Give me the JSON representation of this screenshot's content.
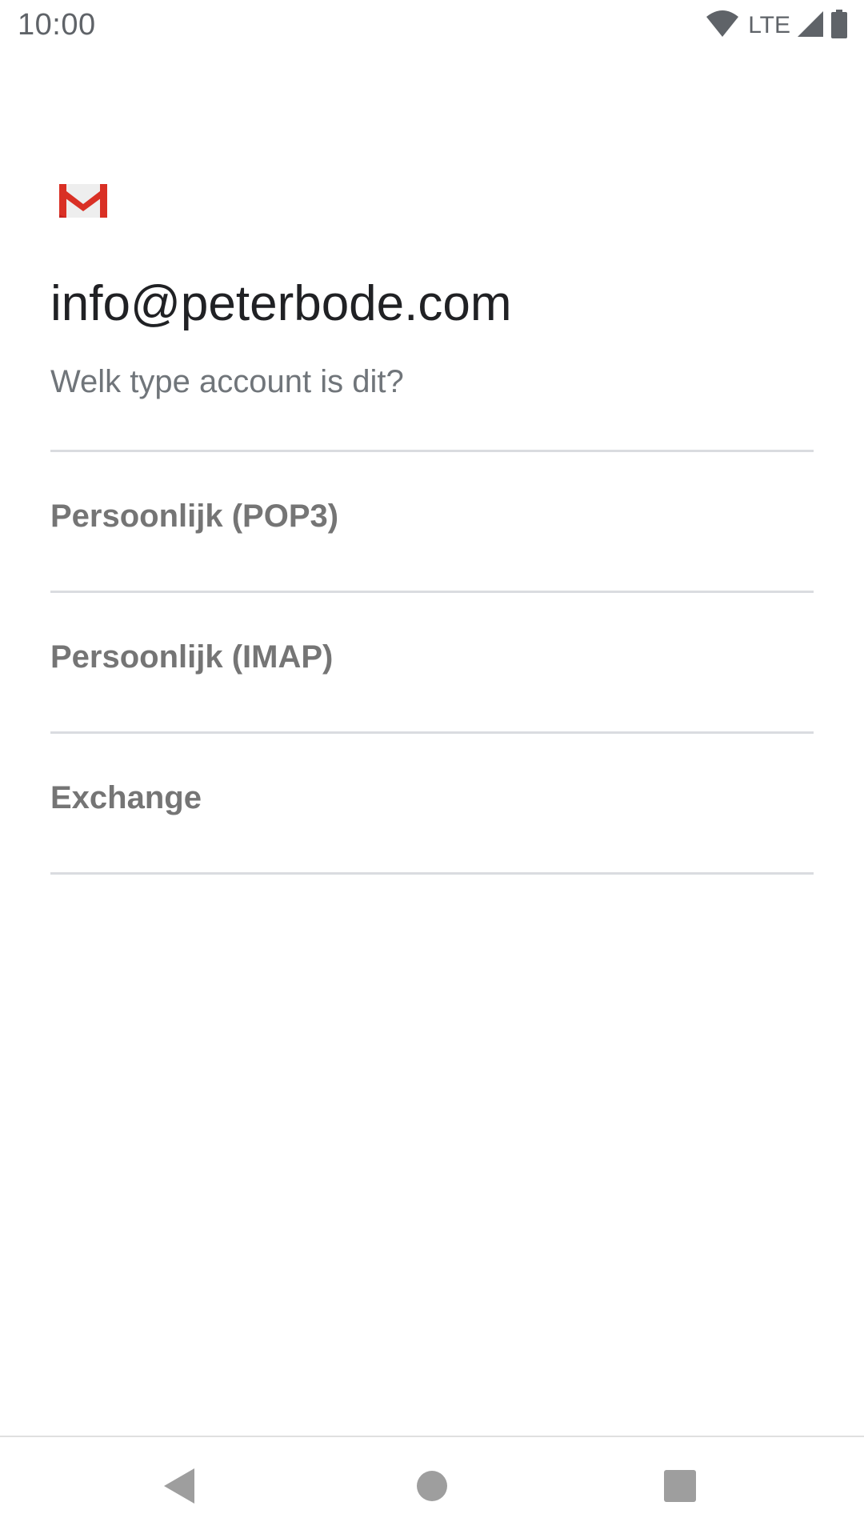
{
  "status_bar": {
    "time": "10:00",
    "network_label": "LTE",
    "icons": [
      "wifi-icon",
      "cell-signal-icon",
      "battery-icon"
    ]
  },
  "header": {
    "logo_icon": "gmail-logo-icon",
    "email": "info@peterbode.com",
    "question": "Welk type account is dit?"
  },
  "account_types": [
    {
      "label": "Persoonlijk (POP3)"
    },
    {
      "label": "Persoonlijk (IMAP)"
    },
    {
      "label": "Exchange"
    }
  ],
  "nav_bar": {
    "icons": [
      "back-icon",
      "home-icon",
      "recents-icon"
    ]
  },
  "colors": {
    "gmail_red": "#d93025",
    "text_primary": "#202124",
    "text_secondary": "#70757a",
    "divider": "#dadce0"
  }
}
